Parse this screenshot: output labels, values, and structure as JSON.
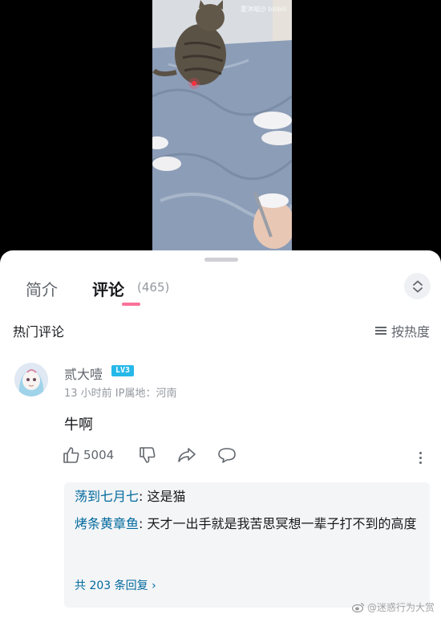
{
  "video": {
    "watermark": "夏沐喵沙 bilibili"
  },
  "tabs": {
    "intro": "简介",
    "comments": "评论",
    "comment_count": "(465)"
  },
  "hot_comments": {
    "title": "热门评论",
    "sort_label": "按热度"
  },
  "comment": {
    "username": "贰大噎",
    "level": "LV3",
    "meta": "13 小时前  IP属地：河南",
    "text": "牛啊",
    "like_count": "5004"
  },
  "replies": [
    {
      "name": "荡到七月七",
      "text": ": 这是猫"
    },
    {
      "name": "烤条黄章鱼",
      "text": ": 天才一出手就是我苦思冥想一辈子打不到的高度"
    }
  ],
  "reply_summary": "共 203 条回复 ›",
  "weibo_watermark": "@迷惑行为大赏",
  "colors": {
    "accent_pink": "#fb7299",
    "link_blue": "#00699d",
    "level_badge": "#25b8e8"
  }
}
